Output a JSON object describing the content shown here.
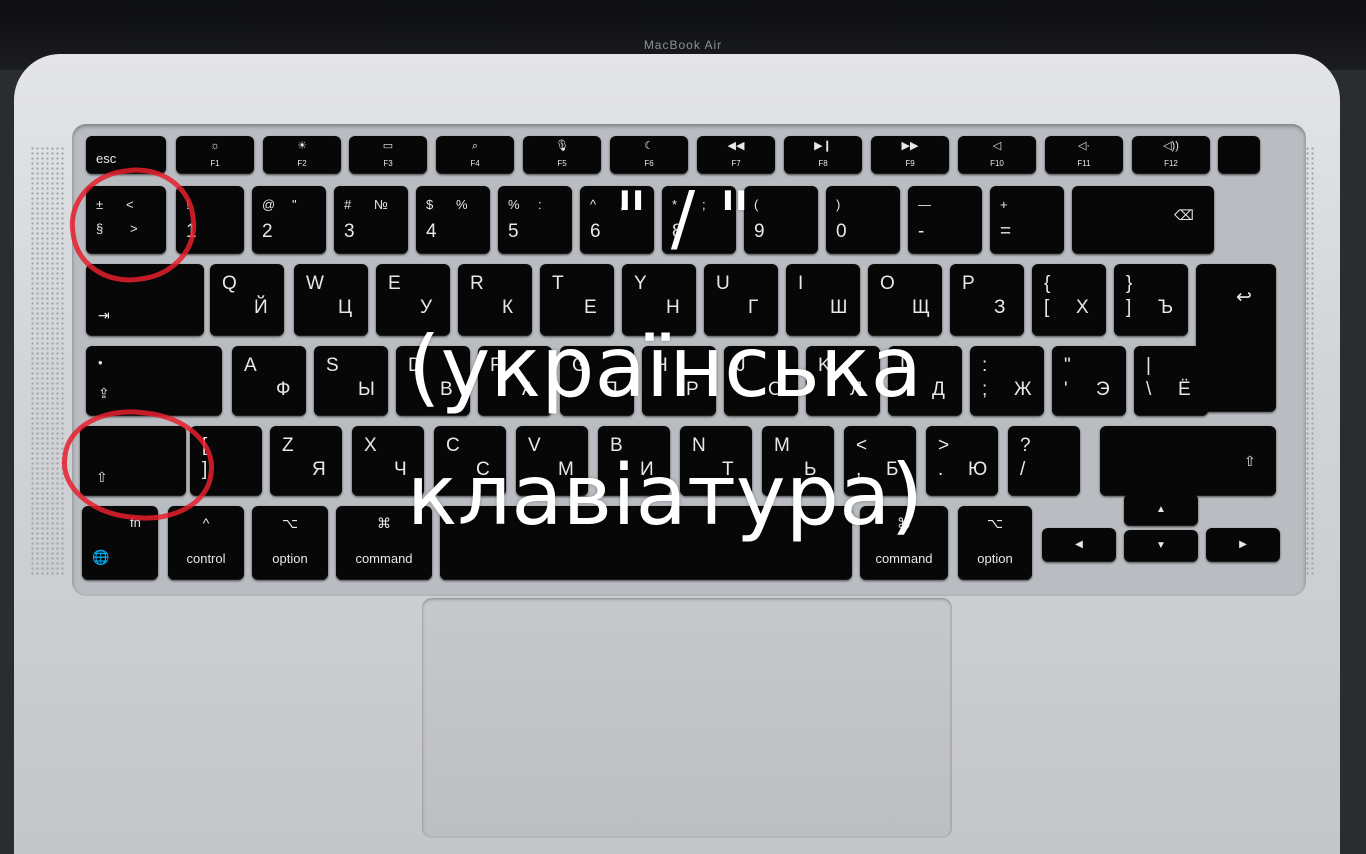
{
  "lid": {
    "label": "MacBook Air"
  },
  "overlay": {
    "line1": "\" / \"",
    "line2": "(українська",
    "line3": "клавіатура)"
  },
  "keyboard": {
    "function_row": [
      {
        "label": "esc",
        "sub": ""
      },
      {
        "label": "☼",
        "sub": "F1"
      },
      {
        "label": "☀",
        "sub": "F2"
      },
      {
        "label": "▭",
        "sub": "F3"
      },
      {
        "label": "⌕",
        "sub": "F4"
      },
      {
        "label": "🎙",
        "sub": "F5"
      },
      {
        "label": "☾",
        "sub": "F6"
      },
      {
        "label": "◀◀",
        "sub": "F7"
      },
      {
        "label": "▶❙",
        "sub": "F8"
      },
      {
        "label": "▶▶",
        "sub": "F9"
      },
      {
        "label": "◁",
        "sub": "F10"
      },
      {
        "label": "◁·",
        "sub": "F11"
      },
      {
        "label": "◁))",
        "sub": "F12"
      },
      {
        "label": "",
        "sub": ""
      }
    ],
    "number_row": [
      {
        "tl": "±",
        "tr": "<",
        "bl": "§",
        "br": ">"
      },
      {
        "tl": "!",
        "tr": "",
        "bl": "1",
        "br": ""
      },
      {
        "tl": "@",
        "tr": "\"",
        "bl": "2",
        "br": ""
      },
      {
        "tl": "#",
        "tr": "№",
        "bl": "3",
        "br": ""
      },
      {
        "tl": "$",
        "tr": "%",
        "bl": "4",
        "br": ""
      },
      {
        "tl": "%",
        "tr": ":",
        "bl": "5",
        "br": ""
      },
      {
        "tl": "^",
        "tr": ",",
        "bl": "6",
        "br": ""
      },
      {
        "tl": "*",
        "tr": ";",
        "bl": "8",
        "br": ""
      },
      {
        "tl": "(",
        "tr": "",
        "bl": "9",
        "br": ""
      },
      {
        "tl": ")",
        "tr": "",
        "bl": "0",
        "br": ""
      },
      {
        "tl": "—",
        "tr": "",
        "bl": "-",
        "br": ""
      },
      {
        "tl": "+",
        "tr": "",
        "bl": "=",
        "br": ""
      },
      {
        "tl": "",
        "tr": "",
        "bl": "",
        "br": "⌫"
      }
    ],
    "qwerty_row": [
      {
        "tl": "",
        "br": "⇥"
      },
      {
        "tl": "Q",
        "br": "Й"
      },
      {
        "tl": "W",
        "br": "Ц"
      },
      {
        "tl": "E",
        "br": "У"
      },
      {
        "tl": "R",
        "br": "К"
      },
      {
        "tl": "T",
        "br": "Е"
      },
      {
        "tl": "Y",
        "br": "Н"
      },
      {
        "tl": "U",
        "br": "Г"
      },
      {
        "tl": "I",
        "br": "Ш"
      },
      {
        "tl": "O",
        "br": "Щ"
      },
      {
        "tl": "P",
        "br": "З"
      },
      {
        "tl": "{",
        "bl": "[",
        "br": "Х"
      },
      {
        "tl": "}",
        "bl": "]",
        "br": "Ъ"
      },
      {
        "tl": "",
        "br": "↩"
      }
    ],
    "home_row": [
      {
        "tl": "•",
        "br": "⇪"
      },
      {
        "tl": "A",
        "br": "Ф"
      },
      {
        "tl": "S",
        "br": "Ы"
      },
      {
        "tl": "D",
        "br": "В"
      },
      {
        "tl": "F",
        "br": "А"
      },
      {
        "tl": "G",
        "br": "П"
      },
      {
        "tl": "H",
        "br": "Р"
      },
      {
        "tl": "J",
        "br": "О"
      },
      {
        "tl": "K",
        "br": "Л"
      },
      {
        "tl": "L",
        "br": "Д"
      },
      {
        "tl": ":",
        "bl": ";",
        "br": "Ж"
      },
      {
        "tl": "\"",
        "bl": "'",
        "br": "Э"
      },
      {
        "tl": "|",
        "bl": "\\",
        "br": "Ё"
      }
    ],
    "bottom_row": [
      {
        "tl": "",
        "br": "⇧"
      },
      {
        "tl": "[",
        "bl": "]",
        "br": ""
      },
      {
        "tl": "Z",
        "br": "Я"
      },
      {
        "tl": "X",
        "br": "Ч"
      },
      {
        "tl": "C",
        "br": "С"
      },
      {
        "tl": "V",
        "br": "М"
      },
      {
        "tl": "B",
        "br": "И"
      },
      {
        "tl": "N",
        "br": "Т"
      },
      {
        "tl": "M",
        "br": "Ь"
      },
      {
        "tl": "<",
        "bl": ",",
        "br": "Б"
      },
      {
        "tl": ">",
        "bl": ".",
        "br": "Ю"
      },
      {
        "tl": "?",
        "bl": "/",
        "br": ""
      },
      {
        "tl": "",
        "br": "⇧"
      }
    ],
    "modifier_row": [
      {
        "top": "fn",
        "bottom": "🌐"
      },
      {
        "top": "^",
        "bottom": "control"
      },
      {
        "top": "⌥",
        "bottom": "option"
      },
      {
        "top": "⌘",
        "bottom": "command"
      },
      {
        "top": "",
        "bottom": ""
      },
      {
        "top": "⌘",
        "bottom": "command"
      },
      {
        "top": "⌥",
        "bottom": "option"
      }
    ],
    "arrows": {
      "up": "▲",
      "left": "◀",
      "down": "▼",
      "right": "▶"
    }
  },
  "colors": {
    "highlight_circle": "#e61e2d",
    "key": "#070707",
    "chassis": "#d2d4d8"
  }
}
